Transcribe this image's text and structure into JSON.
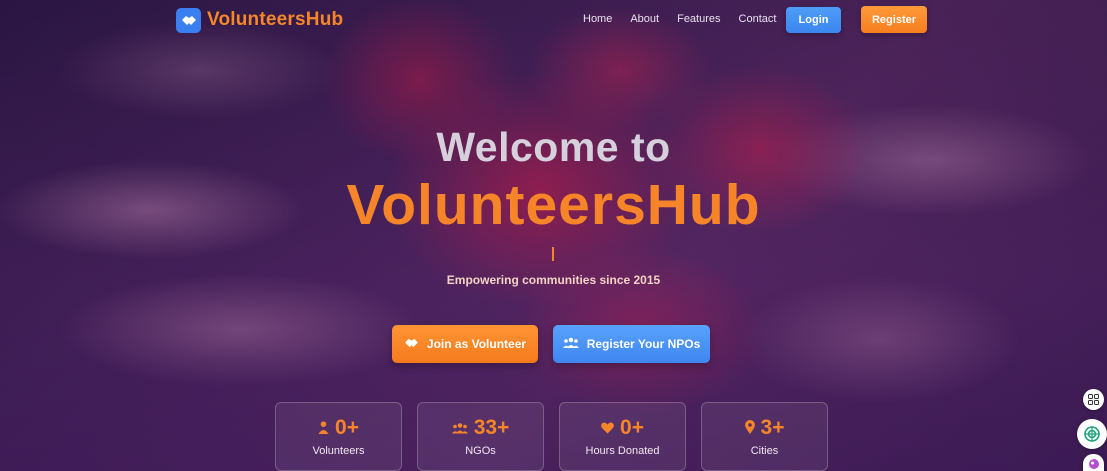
{
  "brand": {
    "name": "VolunteersHub"
  },
  "nav": {
    "links": [
      "Home",
      "About",
      "Features",
      "Contact"
    ],
    "login_label": "Login",
    "register_label": "Register"
  },
  "hero": {
    "title": "Welcome to",
    "brand_title": "VolunteersHub",
    "cursor": "|",
    "tagline": "Empowering communities since 2015",
    "cta_volunteer": "Join as Volunteer",
    "cta_npo": "Register Your NPOs"
  },
  "stats": [
    {
      "icon": "person-icon",
      "value": "0+",
      "label": "Volunteers"
    },
    {
      "icon": "people-group-icon",
      "value": "33+",
      "label": "NGOs"
    },
    {
      "icon": "heart-icon",
      "value": "0+",
      "label": "Hours Donated"
    },
    {
      "icon": "map-pin-icon",
      "value": "3+",
      "label": "Cities"
    }
  ],
  "colors": {
    "accent_orange": "#f6852a",
    "accent_blue": "#3b86f0",
    "overlay_purple": "#4a2358"
  }
}
